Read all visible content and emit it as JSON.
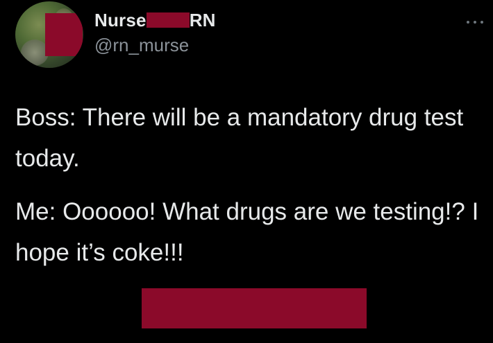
{
  "tweet": {
    "author": {
      "name_prefix": "Nurse",
      "name_suffix": "RN",
      "handle": "@rn_murse",
      "avatar_icon": "profile-photo"
    },
    "more_icon": "ellipsis-icon",
    "body": {
      "paragraphs": [
        "Boss: There will be a mandatory drug test today.",
        "Me: Oooooo! What drugs are we testing!? I hope it’s coke!!!"
      ]
    }
  },
  "colors": {
    "background": "#000000",
    "text_primary": "#e7e9ea",
    "text_secondary": "#8b9299",
    "redaction": "#8b0a2a"
  }
}
